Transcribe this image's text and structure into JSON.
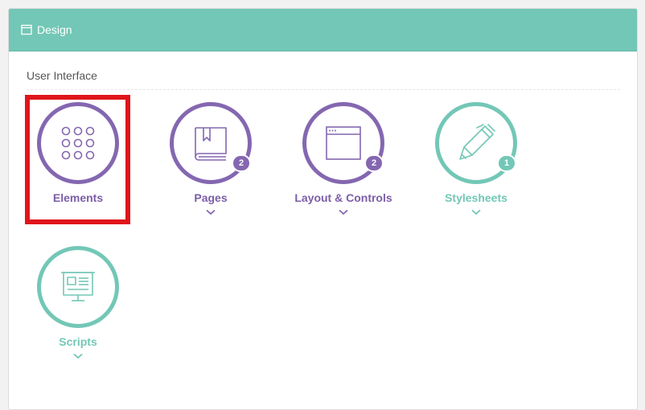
{
  "panel": {
    "title": "Design",
    "title_icon": "window-icon"
  },
  "section": {
    "label": "User Interface"
  },
  "tiles": [
    {
      "label": "Elements",
      "icon": "grid-dots-icon",
      "badge": "",
      "color": "#8467b0",
      "has_chevron": false,
      "highlighted": true
    },
    {
      "label": "Pages",
      "icon": "book-icon",
      "badge": "2",
      "color": "#8467b0",
      "has_chevron": true
    },
    {
      "label": "Layout & Controls",
      "icon": "browser-window-icon",
      "badge": "2",
      "color": "#8467b0",
      "has_chevron": true
    },
    {
      "label": "Stylesheets",
      "icon": "pen-icon",
      "badge": "1",
      "color": "#73c7b6",
      "has_chevron": true
    },
    {
      "label": "Scripts",
      "icon": "presentation-board-icon",
      "badge": "",
      "color": "#73c7b6",
      "has_chevron": true
    }
  ],
  "colors": {
    "header": "#73c7b6",
    "purple": "#8467b0",
    "teal": "#73c7b6",
    "highlight": "#e0151b"
  }
}
